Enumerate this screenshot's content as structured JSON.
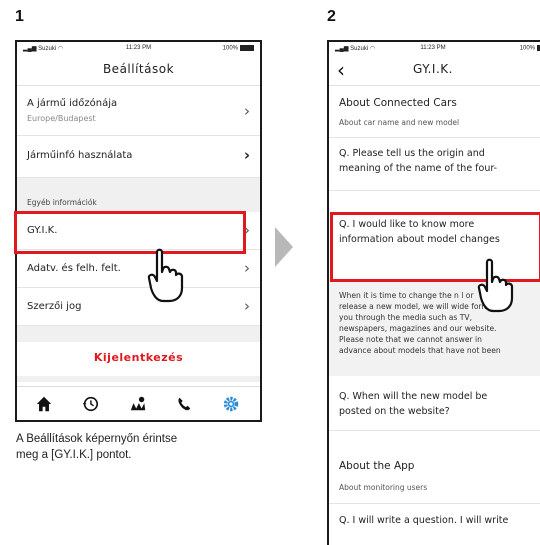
{
  "steps": {
    "one": "1",
    "two": "2"
  },
  "status": {
    "carrier": "Suzuki",
    "time": "11:23 PM",
    "battery": "100%"
  },
  "screen1": {
    "title": "Beállítások",
    "timezone_label": "A jármű időzónája",
    "timezone_value": "Europe/Budapest",
    "vehicle_info": "Járműinfó használata",
    "other_section": "Egyéb információk",
    "faq": "GY.I.K.",
    "privacy": "Adatv. és felh. felt.",
    "copyright": "Szerzői jog",
    "logout": "Kijelentkezés",
    "tabs": [
      "home-icon",
      "history-icon",
      "map-icon",
      "phone-icon",
      "settings-icon"
    ],
    "accent_color": "#e0191f",
    "active_tab_color": "#2a8bd9"
  },
  "caption": {
    "line1": "A Beállítások képernyőn érintse",
    "line2": "meg a [GY.I.K.] pontot."
  },
  "screen2": {
    "title": "GY.I.K.",
    "section1_title": "About Connected Cars",
    "section1_sub": "About car name and new model",
    "q1_line1": "Q. Please tell us the origin and",
    "q1_line2": "meaning of the name of the four-",
    "q2_line1": "Q. I would like to know more",
    "q2_line2": "information about model changes",
    "answer_lines": [
      "When it is time to change the n     l or",
      "release a new model, we will wide   form",
      "you through the media such as TV,",
      "newspapers, magazines and our website.",
      "Please note that we cannot answer in",
      "advance about models that have not been"
    ],
    "q3_line1": "Q. When will the new model be",
    "q3_line2": "posted on the website?",
    "section2_title": "About the App",
    "section2_sub": "About monitoring users",
    "q4_line1": "Q. I will write a question. I will write"
  }
}
